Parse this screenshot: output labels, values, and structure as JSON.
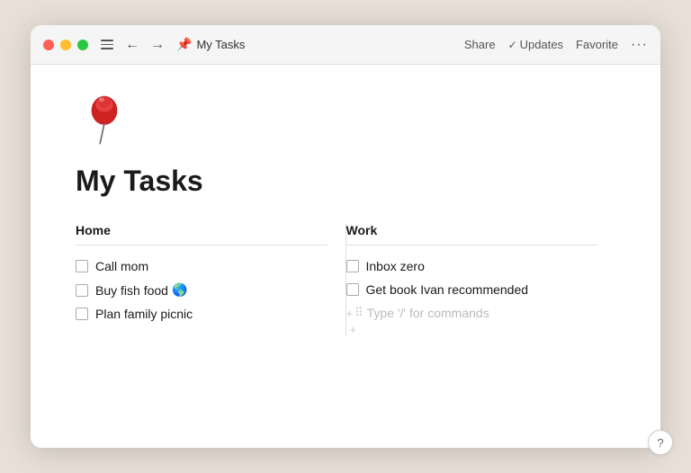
{
  "window": {
    "title": "My Tasks"
  },
  "titlebar": {
    "menu_icon_label": "Menu",
    "back_label": "←",
    "forward_label": "→",
    "page_title": "My Tasks",
    "pin_icon": "📌",
    "share_label": "Share",
    "updates_label": "Updates",
    "favorite_label": "Favorite",
    "more_label": "···"
  },
  "page": {
    "title": "My Tasks",
    "columns": [
      {
        "id": "home",
        "header": "Home",
        "tasks": [
          {
            "id": "call-mom",
            "label": "Call mom",
            "emoji": ""
          },
          {
            "id": "buy-fish-food",
            "label": "Buy fish food",
            "emoji": "🌎"
          },
          {
            "id": "plan-picnic",
            "label": "Plan family picnic",
            "emoji": ""
          }
        ]
      },
      {
        "id": "work",
        "header": "Work",
        "tasks": [
          {
            "id": "inbox-zero",
            "label": "Inbox zero",
            "emoji": ""
          },
          {
            "id": "get-book",
            "label": "Get book Ivan recommended",
            "emoji": ""
          }
        ],
        "placeholder": "Type '/' for commands"
      }
    ]
  },
  "help": {
    "label": "?"
  }
}
